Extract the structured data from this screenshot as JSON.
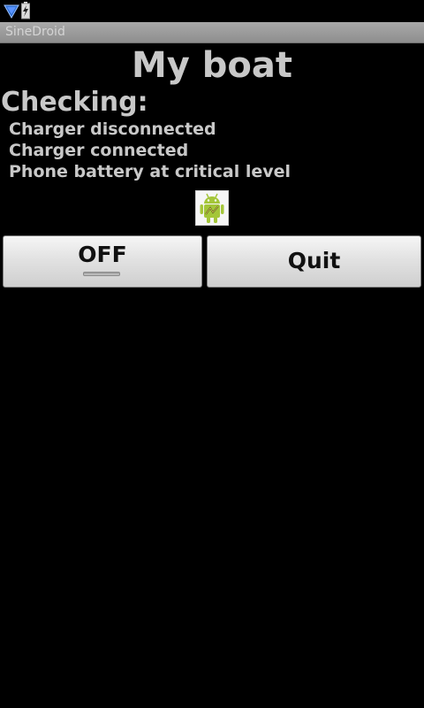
{
  "app": {
    "title": "SineDroid"
  },
  "page": {
    "title": "My boat",
    "checking_heading": "Checking:",
    "checks": [
      "Charger disconnected",
      "Charger connected",
      "Phone battery at critical level"
    ]
  },
  "buttons": {
    "toggle_label": "OFF",
    "quit_label": "Quit"
  },
  "status_bar": {
    "icons": [
      "wifi-icon",
      "battery-charging-icon"
    ]
  },
  "colors": {
    "background": "#000000",
    "text": "#c8c8c8",
    "title_bar": "#9a9a9a",
    "android_green": "#a4c639"
  }
}
